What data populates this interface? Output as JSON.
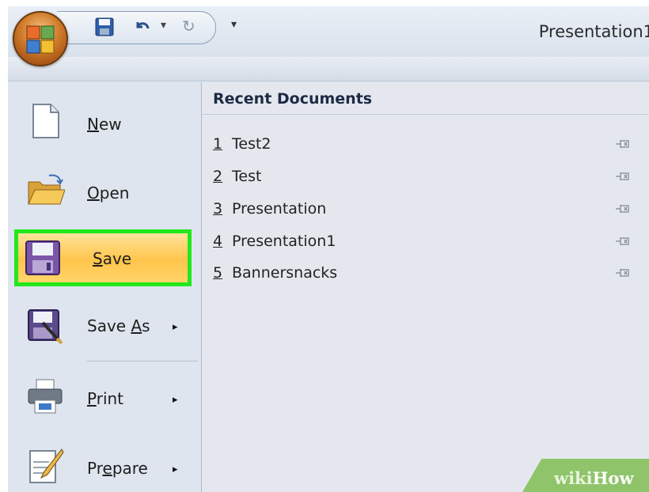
{
  "window": {
    "title": "Presentation1"
  },
  "quick_access": {
    "undo_arrow": "▾",
    "customize": "▾"
  },
  "menu": {
    "items": [
      {
        "label": "New",
        "mnemonic": "N",
        "rest": "ew"
      },
      {
        "label": "Open",
        "mnemonic": "O",
        "rest": "pen"
      },
      {
        "label": "Save",
        "mnemonic": "S",
        "rest": "ave",
        "highlighted": true
      },
      {
        "label": "Save As",
        "pre": "Save ",
        "mnemonic": "A",
        "rest": "s",
        "has_submenu": true
      },
      {
        "label": "Print",
        "mnemonic": "P",
        "rest": "rint",
        "has_submenu": true
      },
      {
        "label": "Prepare",
        "pre": "Pr",
        "mnemonic": "e",
        "rest": "pare",
        "has_submenu": true
      }
    ],
    "submenu_arrow": "▸"
  },
  "recent": {
    "title": "Recent Documents",
    "items": [
      {
        "num": "1",
        "name": "Test2"
      },
      {
        "num": "2",
        "name": "Test"
      },
      {
        "num": "3",
        "name": "Presentation"
      },
      {
        "num": "4",
        "name": "Presentation1"
      },
      {
        "num": "5",
        "name": "Bannersnacks"
      }
    ]
  },
  "watermark": {
    "part1": "wiki",
    "part2": "How"
  },
  "colors": {
    "highlight_border": "#22e81c",
    "highlight_fill": "#ffc54c",
    "watermark": "#8fc46a"
  }
}
